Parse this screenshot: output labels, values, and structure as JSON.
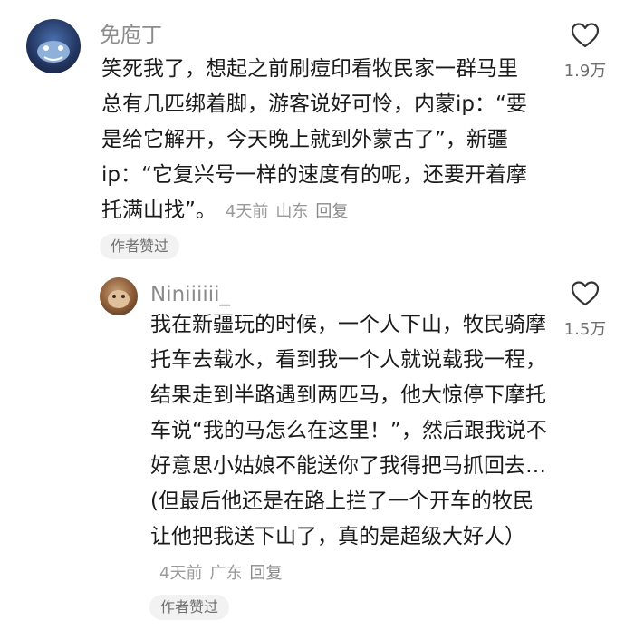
{
  "comments": [
    {
      "username": "免庖丁",
      "text": "笑死我了，想起之前刷痘印看牧民家一群马里总有几匹绑着脚，游客说好可怜，内蒙ip：“要是给它解开，今天晚上就到外蒙古了”，新疆ip：“它复兴号一样的速度有的呢，还要开着摩托满山找”。",
      "time": "4天前",
      "location": "山东",
      "reply_label": "回复",
      "badge": "作者赞过",
      "likes": "1.9万"
    },
    {
      "username": "Niniiiiii_",
      "text": "我在新疆玩的时候，一个人下山，牧民骑摩托车去载水，看到我一个人就说载我一程，结果走到半路遇到两匹马，他大惊停下摩托车说“我的马怎么在这里！”，然后跟我说不好意思小姑娘不能送你了我得把马抓回去…(但最后他还是在路上拦了一个开车的牧民让他把我送下山了，真的是超级大好人）",
      "time": "4天前",
      "location": "广东",
      "reply_label": "回复",
      "badge": "作者赞过",
      "likes": "1.5万"
    }
  ],
  "icons": {
    "like": "heart-outline-icon"
  }
}
